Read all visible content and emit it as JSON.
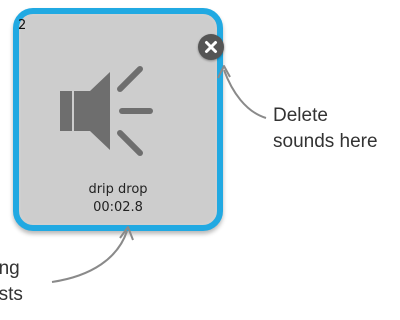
{
  "tile": {
    "index": "2",
    "name": "drip drop",
    "length": "00:02.8",
    "icon": "speaker-icon"
  },
  "delete_button": {
    "icon": "close-icon"
  },
  "callouts": {
    "delete_line1": "Delete",
    "delete_line2": "sounds here",
    "length_line1": "ong",
    "length_line2": "asts"
  },
  "colors": {
    "tile_border": "#21a9e2",
    "tile_background": "#cdcdcd",
    "icon": "#6e6e6e",
    "delete_button": "#555555",
    "arrow": "#8a8a8a"
  }
}
